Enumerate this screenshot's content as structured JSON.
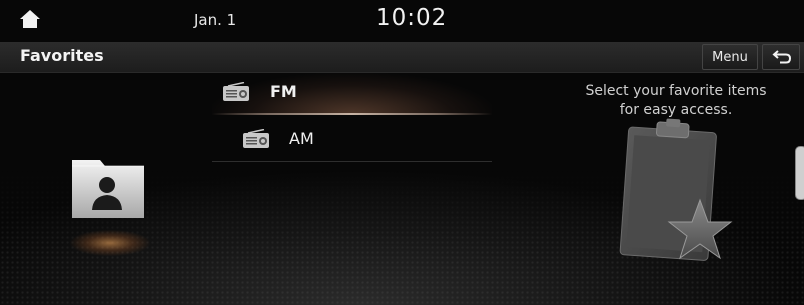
{
  "status_bar": {
    "date": "Jan. 1",
    "time": "10:02"
  },
  "header": {
    "title": "Favorites",
    "menu_label": "Menu"
  },
  "list": {
    "items": [
      {
        "label": "FM",
        "selected": true,
        "icon": "radio-icon"
      },
      {
        "label": "AM",
        "selected": false,
        "icon": "radio-icon"
      }
    ]
  },
  "hint": {
    "line1": "Select your favorite items",
    "line2": "for easy access."
  },
  "icons": {
    "home": "home-icon",
    "back": "back-arrow-icon",
    "folder": "contact-folder-icon",
    "clipboard": "clipboard-star-icon"
  },
  "colors": {
    "background": "#080808",
    "title_bar": "#242424",
    "highlight": "#8c5f46",
    "text": "#f0f0f0"
  }
}
